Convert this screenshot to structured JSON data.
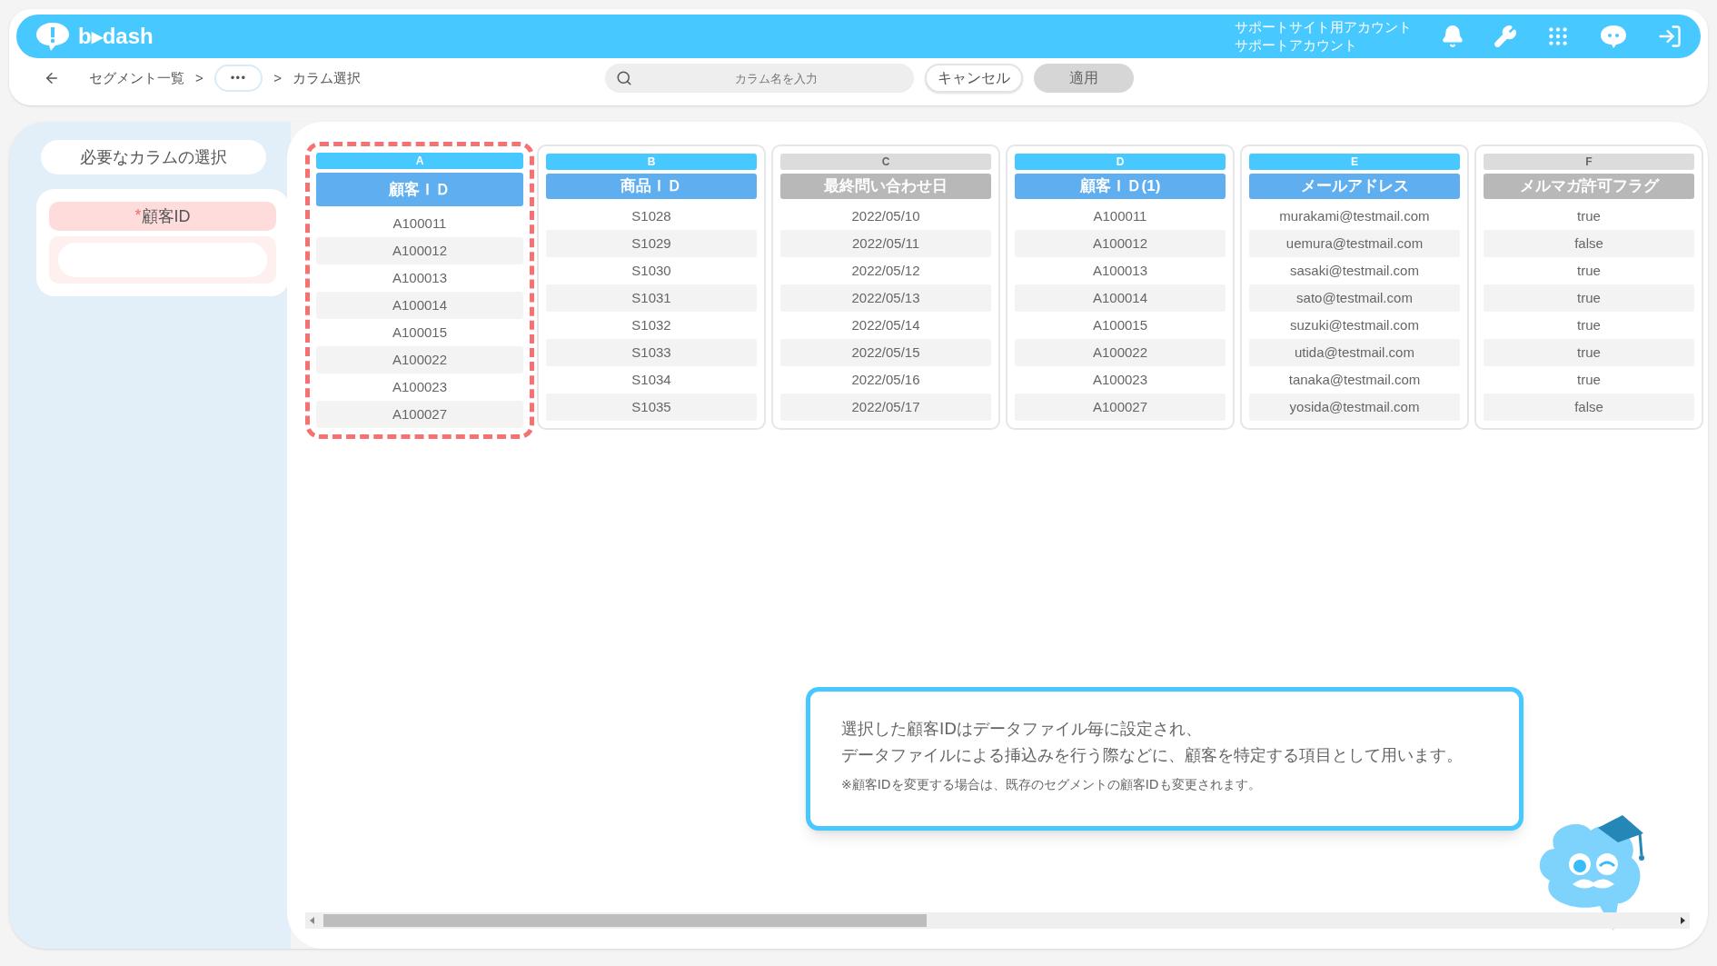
{
  "header": {
    "logo": "b▸dash",
    "account": [
      "サポートサイト用アカウント",
      "サポートアカウント"
    ]
  },
  "breadcrumb": {
    "items": [
      {
        "kind": "link",
        "label": "セグメント一覧"
      },
      {
        "kind": "sep",
        "label": ">"
      },
      {
        "kind": "more",
        "label": "•••"
      },
      {
        "kind": "sep",
        "label": ">"
      },
      {
        "kind": "current",
        "label": "カラム選択"
      }
    ]
  },
  "search": {
    "placeholder": "カラム名を入力"
  },
  "buttons": [
    {
      "label": "キャンセル",
      "disabled": false
    },
    {
      "label": "適用",
      "disabled": true
    }
  ],
  "sidebar": {
    "title": "必要なカラムの選択",
    "fields": [
      {
        "mark": "*",
        "label": "顧客ID"
      }
    ]
  },
  "columns": [
    {
      "letter": "A",
      "name": "顧客ＩＤ",
      "enabled": true,
      "selected": true,
      "cells": [
        "A100011",
        "A100012",
        "A100013",
        "A100014",
        "A100015",
        "A100022",
        "A100023",
        "A100027"
      ]
    },
    {
      "letter": "B",
      "name": "商品ＩＤ",
      "enabled": true,
      "selected": false,
      "cells": [
        "S1028",
        "S1029",
        "S1030",
        "S1031",
        "S1032",
        "S1033",
        "S1034",
        "S1035"
      ]
    },
    {
      "letter": "C",
      "name": "最終問い合わせ日",
      "enabled": false,
      "selected": false,
      "cells": [
        "2022/05/10",
        "2022/05/11",
        "2022/05/12",
        "2022/05/13",
        "2022/05/14",
        "2022/05/15",
        "2022/05/16",
        "2022/05/17"
      ]
    },
    {
      "letter": "D",
      "name": "顧客ＩＤ(1)",
      "enabled": true,
      "selected": false,
      "cells": [
        "A100011",
        "A100012",
        "A100013",
        "A100014",
        "A100015",
        "A100022",
        "A100023",
        "A100027"
      ]
    },
    {
      "letter": "E",
      "name": "メールアドレス",
      "enabled": true,
      "selected": false,
      "cells": [
        "murakami@testmail.com",
        "uemura@testmail.com",
        "sasaki@testmail.com",
        "sato@testmail.com",
        "suzuki@testmail.com",
        "utida@testmail.com",
        "tanaka@testmail.com",
        "yosida@testmail.com"
      ]
    },
    {
      "letter": "F",
      "name": "メルマガ許可フラグ",
      "enabled": false,
      "selected": false,
      "cells": [
        "true",
        "false",
        "true",
        "true",
        "true",
        "true",
        "true",
        "false"
      ]
    }
  ],
  "tip": {
    "lines": [
      "選択した顧客IDはデータファイル毎に設定され、",
      "データファイルによる挿込みを行う際などに、顧客を特定する項目として用います。"
    ],
    "note": "※顧客IDを変更する場合は、既存のセグメントの顧客IDも変更されます。"
  }
}
